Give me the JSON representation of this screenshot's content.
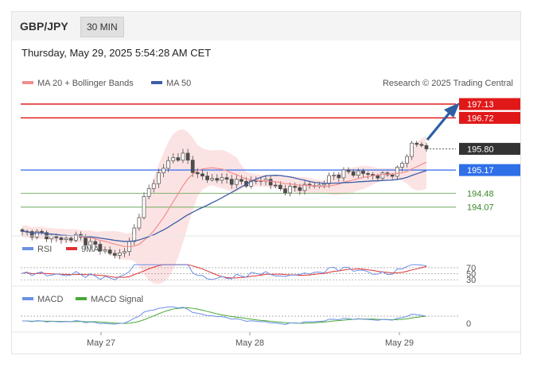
{
  "header": {
    "symbol": "GBP/JPY",
    "timeframe": "30 MIN"
  },
  "timestamp": "Thursday, May 29, 2025 5:54:28 AM CET",
  "legend": {
    "ma20_label": "MA 20 + Bollinger Bands",
    "ma50_label": "MA 50",
    "credit": "Research © 2025 Trading Central",
    "rsi_label": "RSI",
    "rsi_ma_label": "9MA",
    "macd_label": "MACD",
    "macd_signal_label": "MACD Signal"
  },
  "colors": {
    "candle": "#4d4d4d",
    "ma20": "#f28e8e",
    "band": "#fbdada",
    "ma50": "#3c5ea8",
    "resistance": "#e02020",
    "support_primary": "#4477ee",
    "support": "#6aaa5a",
    "arrow": "#2e5fa3",
    "rsi": "#6a8fe6",
    "rsi_ma": "#e03030",
    "macd": "#6a8fe6",
    "macd_signal": "#49a836"
  },
  "x_labels": [
    "May 27",
    "May 28",
    "May 29"
  ],
  "chart_data": {
    "type": "line",
    "price_levels": {
      "resistance": [
        197.13,
        196.72
      ],
      "current": 195.8,
      "support": [
        195.17,
        194.48,
        194.07
      ]
    },
    "price_series_approx": [
      193.3,
      193.3,
      193.2,
      193.1,
      193.2,
      193.0,
      192.8,
      192.6,
      193.0,
      194.3,
      195.0,
      195.5,
      195.6,
      195.0,
      194.9,
      194.9,
      194.8,
      194.8,
      194.9,
      194.6,
      194.6,
      194.7,
      194.7,
      195.0,
      195.1,
      195.1,
      195.0,
      195.0,
      195.2,
      196.0,
      195.8
    ],
    "rsi_levels": [
      70,
      50,
      30
    ],
    "macd_zero": 0
  }
}
